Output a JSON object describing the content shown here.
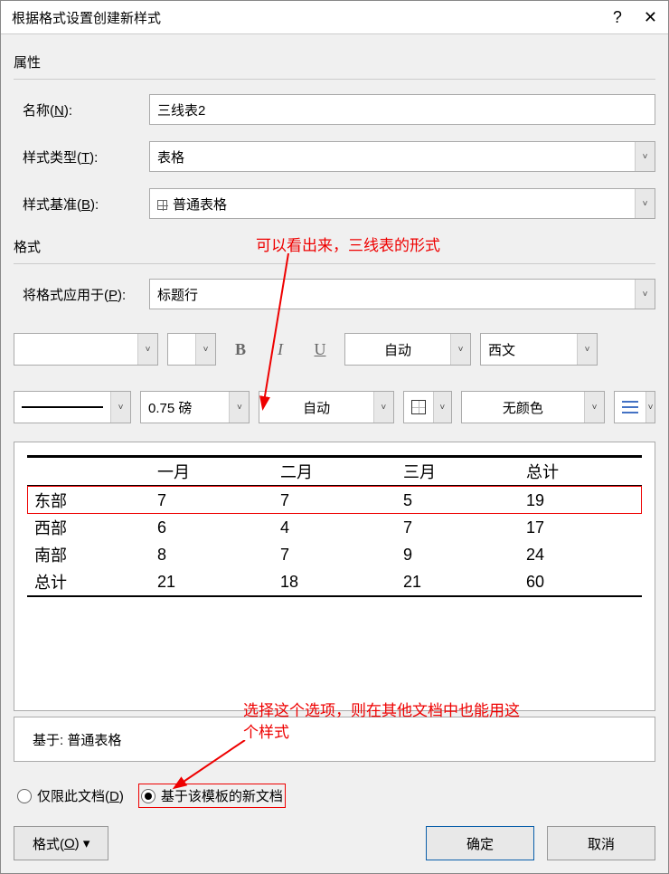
{
  "titlebar": {
    "title": "根据格式设置创建新样式"
  },
  "sections": {
    "properties_label": "属性",
    "formatting_label": "格式"
  },
  "form": {
    "name_label": "名称(N):",
    "name_value": "三线表2",
    "type_label": "样式类型(T):",
    "type_value": "表格",
    "based_label": "样式基准(B):",
    "based_value": "普通表格",
    "apply_label": "将格式应用于(P):",
    "apply_value": "标题行"
  },
  "toolbar": {
    "font_name": "",
    "font_size": "",
    "auto_color_label": "自动",
    "script_label": "西文",
    "line_weight": "0.75 磅",
    "line_color_label": "自动",
    "fill_label": "无颜色"
  },
  "preview": {
    "headers": [
      "",
      "一月",
      "二月",
      "三月",
      "总计"
    ],
    "rows": [
      {
        "label": "东部",
        "vals": [
          "7",
          "7",
          "5",
          "19"
        ]
      },
      {
        "label": "西部",
        "vals": [
          "6",
          "4",
          "7",
          "17"
        ]
      },
      {
        "label": "南部",
        "vals": [
          "8",
          "7",
          "9",
          "24"
        ]
      },
      {
        "label": "总计",
        "vals": [
          "21",
          "18",
          "21",
          "60"
        ]
      }
    ]
  },
  "footer": {
    "based_on_text": "基于: 普通表格"
  },
  "radio": {
    "only_doc_label": "仅限此文档(D)",
    "template_label": "基于该模板的新文档"
  },
  "buttons": {
    "format_menu": "格式(O) ▾",
    "ok": "确定",
    "cancel": "取消"
  },
  "annotations": {
    "top": "可以看出来，三线表的形式",
    "bottom1": "选择这个选项，则在其他文档中也能用这",
    "bottom2": "个样式"
  }
}
